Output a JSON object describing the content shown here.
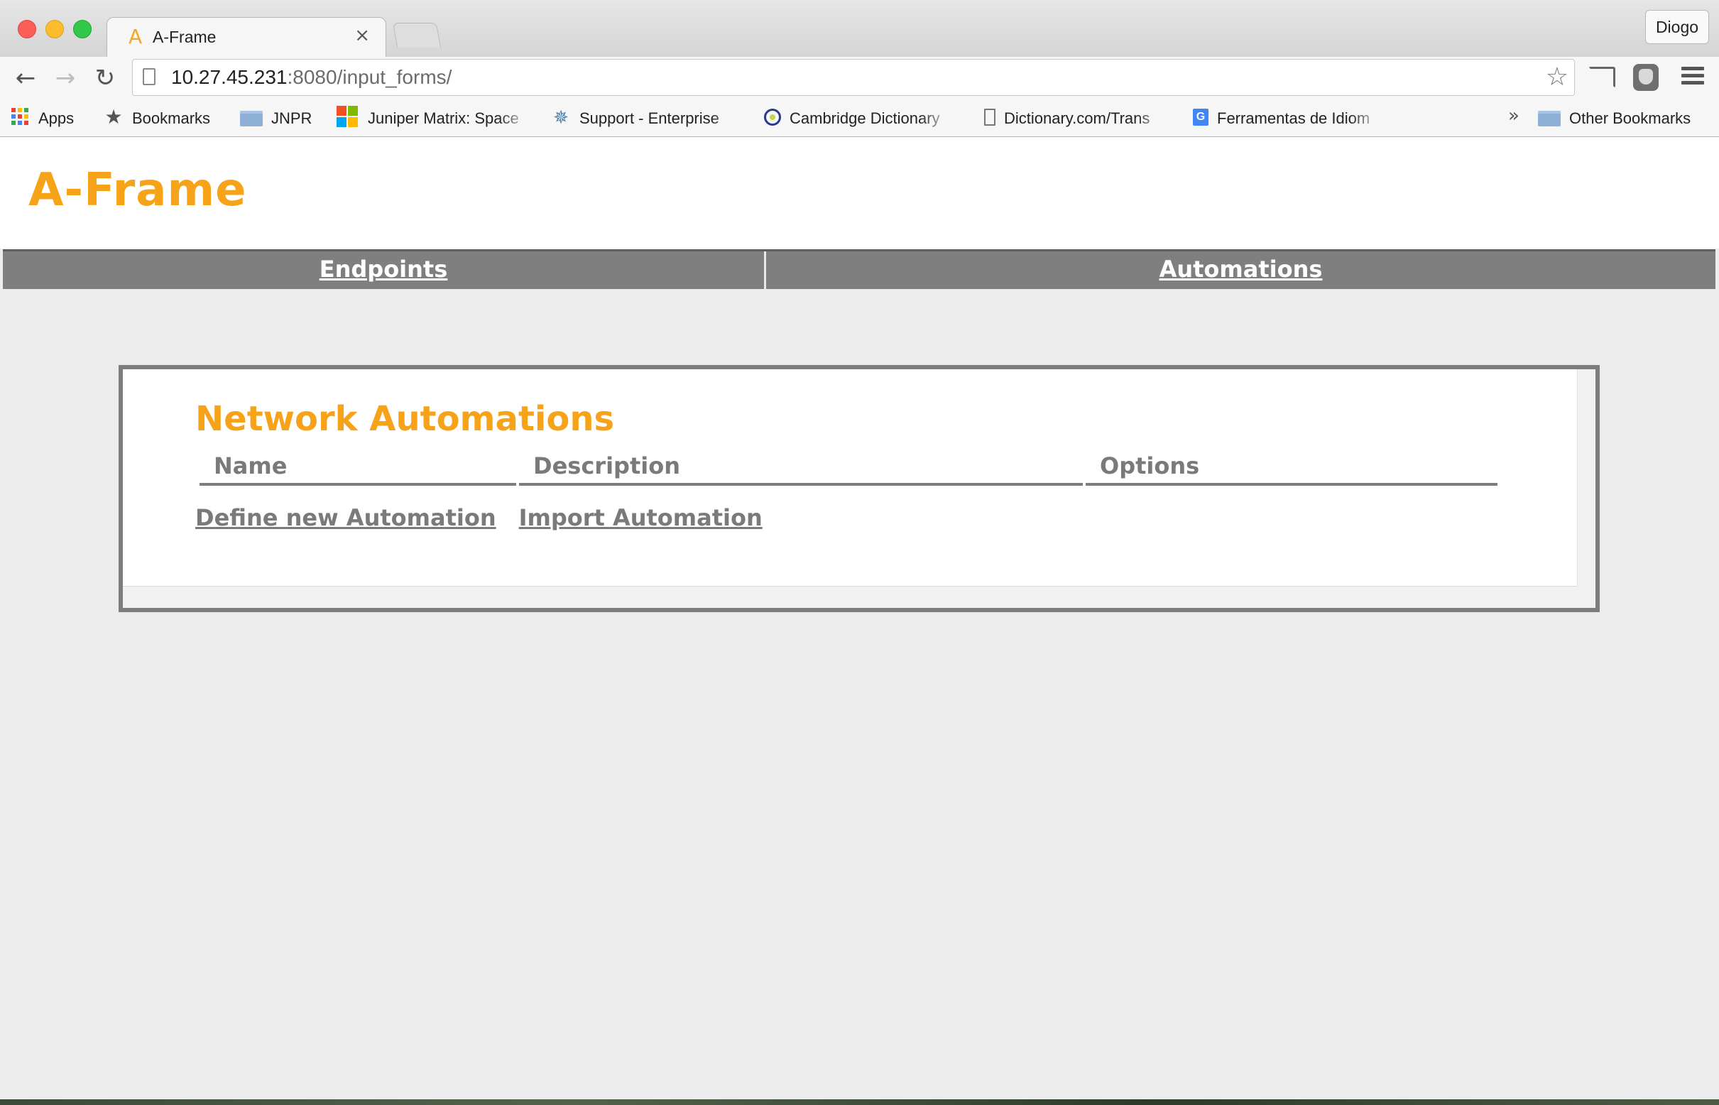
{
  "browser": {
    "tab": {
      "title": "A-Frame",
      "favicon_letter": "A",
      "close_glyph": "×"
    },
    "profile_name": "Diogo",
    "url": {
      "host": "10.27.45.231",
      "rest": ":8080/input_forms/"
    },
    "bookmarks": [
      {
        "label": "Apps",
        "icon": "apps-grid-icon"
      },
      {
        "label": "Bookmarks",
        "icon": "star-icon"
      },
      {
        "label": "JNPR",
        "icon": "folder-icon"
      },
      {
        "label": "Juniper Matrix: Space",
        "icon": "microsoft-logo-icon"
      },
      {
        "label": "Support - Enterprise",
        "icon": "burst-icon"
      },
      {
        "label": "Cambridge Dictionary",
        "icon": "cambridge-icon"
      },
      {
        "label": "Dictionary.com/Trans",
        "icon": "document-icon"
      },
      {
        "label": "Ferramentas de Idiom",
        "icon": "google-translate-icon"
      }
    ],
    "overflow_glyph": "»",
    "other_bookmarks": "Other Bookmarks"
  },
  "site": {
    "title": "A-Frame",
    "nav": [
      {
        "label": "Endpoints"
      },
      {
        "label": "Automations"
      }
    ]
  },
  "panel": {
    "title": "Network Automations",
    "columns": [
      "Name",
      "Description",
      "Options"
    ],
    "actions": [
      {
        "label": "Define new Automation"
      },
      {
        "label": "Import Automation"
      }
    ]
  },
  "colors": {
    "accent": "#f7a31a",
    "nav_background": "#7f7f7f",
    "text_muted": "#7a7a7a"
  }
}
